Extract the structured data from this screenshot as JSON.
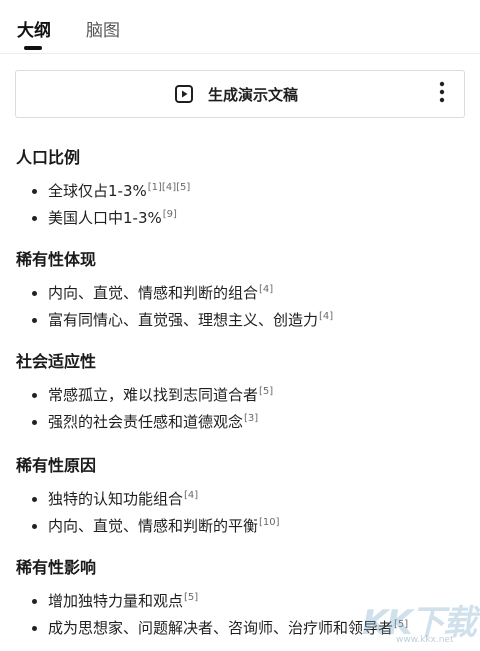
{
  "tabs": [
    {
      "label": "大纲",
      "active": true
    },
    {
      "label": "脑图",
      "active": false
    }
  ],
  "generate_button": {
    "label": "生成演示文稿",
    "icon": "play-square-icon"
  },
  "more_menu": {
    "icon": "more-vertical-icon"
  },
  "sections": [
    {
      "title": "人口比例",
      "items": [
        {
          "text": "全球仅占1-3%",
          "cite": "[1][4][5]"
        },
        {
          "text": "美国人口中1-3%",
          "cite": "[9]"
        }
      ]
    },
    {
      "title": "稀有性体现",
      "items": [
        {
          "text": "内向、直觉、情感和判断的组合",
          "cite": "[4]"
        },
        {
          "text": "富有同情心、直觉强、理想主义、创造力",
          "cite": "[4]"
        }
      ]
    },
    {
      "title": "社会适应性",
      "items": [
        {
          "text": "常感孤立，难以找到志同道合者",
          "cite": "[5]"
        },
        {
          "text": "强烈的社会责任感和道德观念",
          "cite": "[3]"
        }
      ]
    },
    {
      "title": "稀有性原因",
      "items": [
        {
          "text": "独特的认知功能组合",
          "cite": "[4]"
        },
        {
          "text": "内向、直觉、情感和判断的平衡",
          "cite": "[10]"
        }
      ]
    },
    {
      "title": "稀有性影响",
      "items": [
        {
          "text": "增加独特力量和观点",
          "cite": "[5]"
        },
        {
          "text": "成为思想家、问题解决者、咨询师、治疗师和领导者",
          "cite": "[5]"
        }
      ]
    }
  ],
  "watermark": {
    "text": "KK下载",
    "url": "www.kkx.net"
  }
}
